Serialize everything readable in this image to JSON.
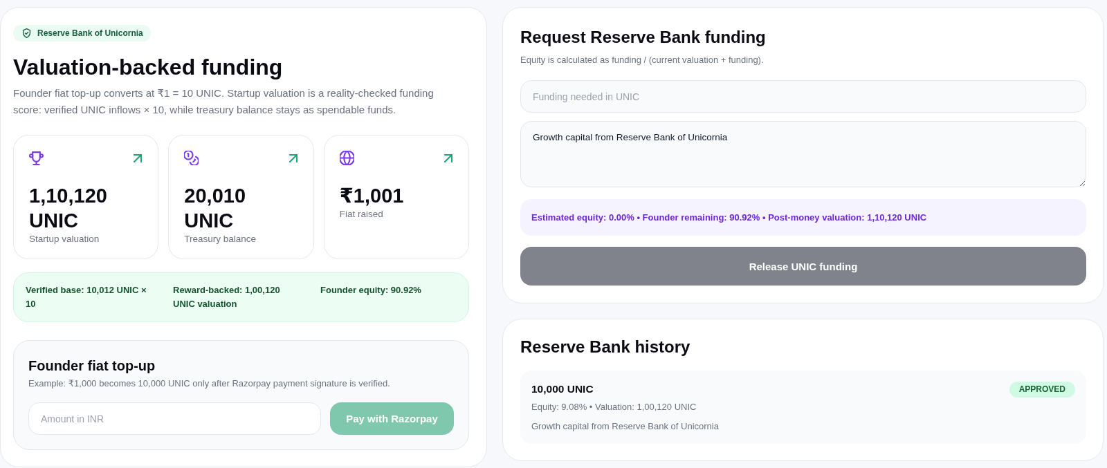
{
  "funding_overview": {
    "badge": "Reserve Bank of Unicornia",
    "title": "Valuation-backed funding",
    "description": "Founder fiat top-up converts at ₹1 = 10 UNIC. Startup valuation is a reality-checked funding score: verified UNIC inflows × 10, while treasury balance stays as spendable funds.",
    "stats": [
      {
        "kind": "trophy",
        "value": "1,10,120 UNIC",
        "label": "Startup valuation"
      },
      {
        "kind": "coins",
        "value": "20,010 UNIC",
        "label": "Treasury balance"
      },
      {
        "kind": "globe",
        "value": "₹1,001",
        "label": "Fiat raised"
      }
    ],
    "summary": [
      "Verified base: 10,012 UNIC × 10",
      "Reward-backed: 1,00,120 UNIC valuation",
      "Founder equity: 90.92%"
    ],
    "fiat_topup": {
      "title": "Founder fiat top-up",
      "description": "Example: ₹1,000 becomes 10,000 UNIC only after Razorpay payment signature is verified.",
      "amount_field": {
        "placeholder": "Amount in INR"
      },
      "pay_button": {
        "label": "Pay with Razorpay",
        "disabled": true
      }
    }
  },
  "funding_request": {
    "title": "Request Reserve Bank funding",
    "description": "Equity is calculated as funding / (current valuation + funding).",
    "amount_field": {
      "placeholder": "Funding needed in UNIC"
    },
    "note_field": {
      "value": "Growth capital from Reserve Bank of Unicornia"
    },
    "estimate": "Estimated equity: 0.00% • Founder remaining: 90.92% • Post-money valuation: 1,10,120 UNIC",
    "release_button": {
      "label": "Release UNIC funding",
      "disabled": true
    }
  },
  "history": {
    "title": "Reserve Bank history",
    "entries": [
      {
        "amount": "10,000 UNIC",
        "status": "APPROVED",
        "details": "Equity: 9.08% • Valuation: 1,00,120 UNIC",
        "note": "Growth capital from Reserve Bank of Unicornia"
      }
    ]
  }
}
